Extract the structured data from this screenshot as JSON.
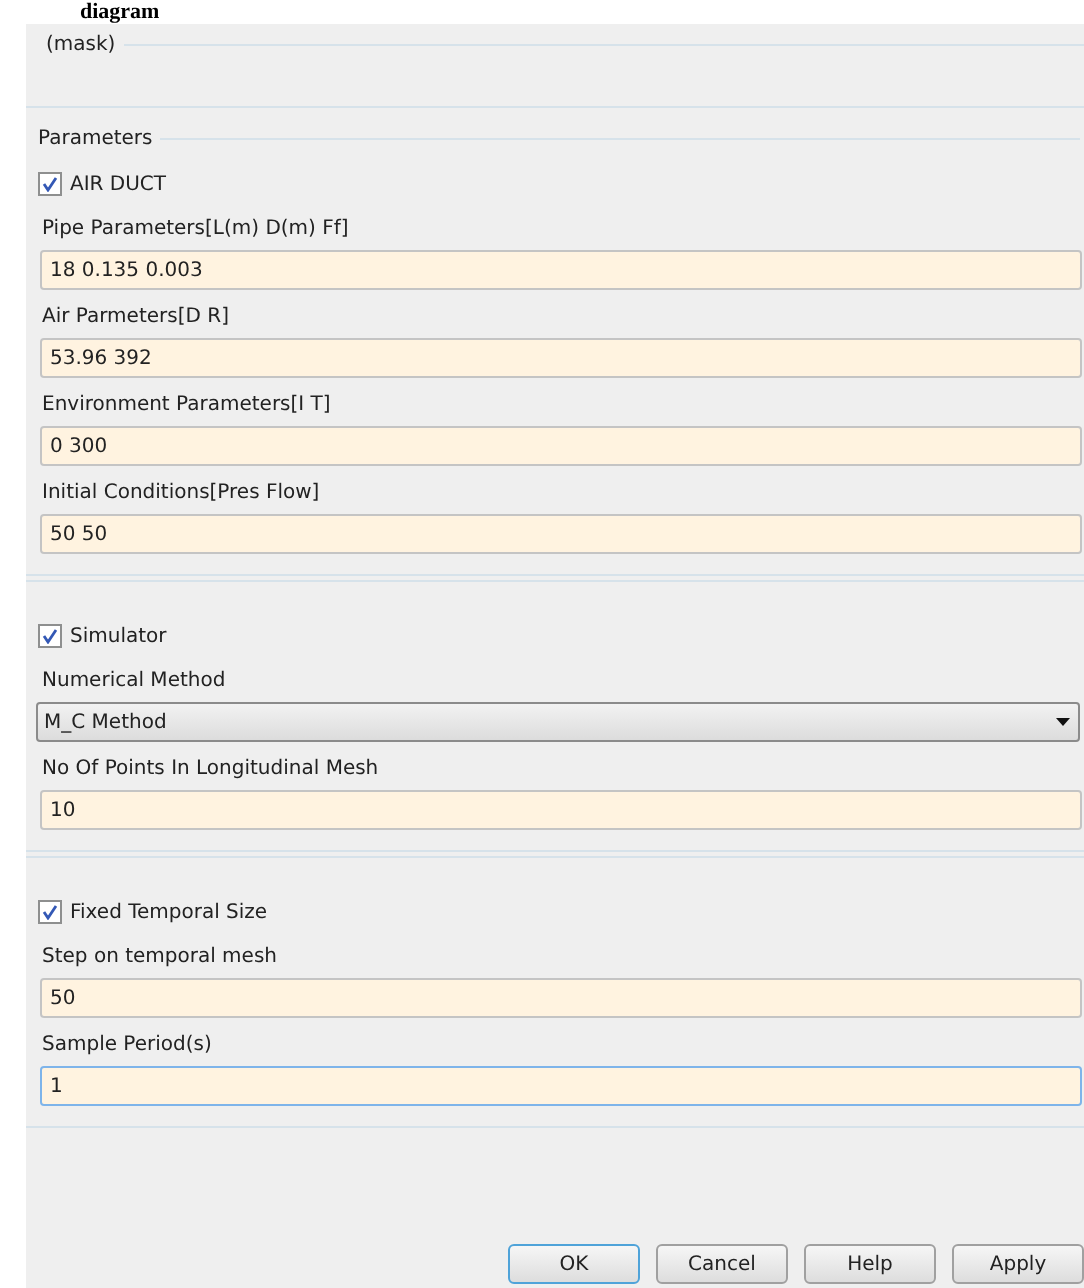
{
  "page_heading": "diagram",
  "mask": {
    "title": "(mask)"
  },
  "groups": [
    {
      "title": "Parameters",
      "items": [
        {
          "kind": "checkbox",
          "label": "AIR DUCT",
          "checked": true
        },
        {
          "kind": "field",
          "label": "Pipe Parameters[L(m) D(m) Ff]",
          "value": "18 0.135 0.003",
          "focused": false
        },
        {
          "kind": "field",
          "label": "Air Parmeters[D R]",
          "value": "53.96 392",
          "focused": false
        },
        {
          "kind": "field",
          "label": "Environment Parameters[I T]",
          "value": "0 300",
          "focused": false
        },
        {
          "kind": "field",
          "label": "Initial Conditions[Pres Flow]",
          "value": "50 50",
          "focused": false
        }
      ]
    },
    {
      "items": [
        {
          "kind": "checkbox",
          "label": "Simulator",
          "checked": true
        },
        {
          "kind": "dropdown",
          "label": "Numerical Method",
          "value": "M_C Method"
        },
        {
          "kind": "field",
          "label": "No Of Points In Longitudinal Mesh",
          "value": "10",
          "focused": false
        }
      ]
    },
    {
      "items": [
        {
          "kind": "checkbox",
          "label": "Fixed Temporal Size",
          "checked": true
        },
        {
          "kind": "field",
          "label": "Step on temporal mesh",
          "value": "50",
          "focused": false
        },
        {
          "kind": "field",
          "label": "Sample Period(s)",
          "value": "1",
          "focused": true
        }
      ]
    }
  ],
  "buttons": [
    {
      "label": "OK",
      "focused": true
    },
    {
      "label": "Cancel",
      "focused": false
    },
    {
      "label": "Help",
      "focused": false
    },
    {
      "label": "Apply",
      "focused": false
    }
  ]
}
